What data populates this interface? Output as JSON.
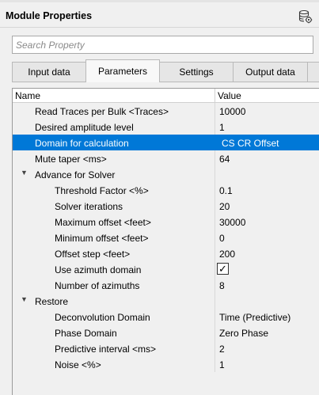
{
  "panel": {
    "title": "Module Properties"
  },
  "search": {
    "placeholder": "Search Property"
  },
  "tabs": [
    {
      "label": "Input data"
    },
    {
      "label": "Parameters"
    },
    {
      "label": "Settings"
    },
    {
      "label": "Output data"
    }
  ],
  "grid": {
    "header_name": "Name",
    "header_value": "Value",
    "rows": [
      {
        "name": "Read Traces per Bulk <Traces>",
        "value": "10000"
      },
      {
        "name": "Desired amplitude level",
        "value": "1"
      },
      {
        "name": "Domain for calculation",
        "value": "CS CR Offset"
      },
      {
        "name": "Mute taper <ms>",
        "value": "64"
      },
      {
        "name": "Advance for Solver",
        "value": ""
      },
      {
        "name": "Threshold Factor <%>",
        "value": "0.1"
      },
      {
        "name": "Solver iterations",
        "value": "20"
      },
      {
        "name": "Maximum offset <feet>",
        "value": "30000"
      },
      {
        "name": "Minimum offset <feet>",
        "value": "0"
      },
      {
        "name": "Offset step <feet>",
        "value": "200"
      },
      {
        "name": "Use azimuth domain",
        "value": "✓"
      },
      {
        "name": "Number of azimuths",
        "value": "8"
      },
      {
        "name": "Restore",
        "value": ""
      },
      {
        "name": "Deconvolution Domain",
        "value": "Time (Predictive)"
      },
      {
        "name": "Phase Domain",
        "value": "Zero Phase"
      },
      {
        "name": "Predictive interval <ms>",
        "value": "2"
      },
      {
        "name": "Noise <%>",
        "value": "1"
      }
    ]
  }
}
